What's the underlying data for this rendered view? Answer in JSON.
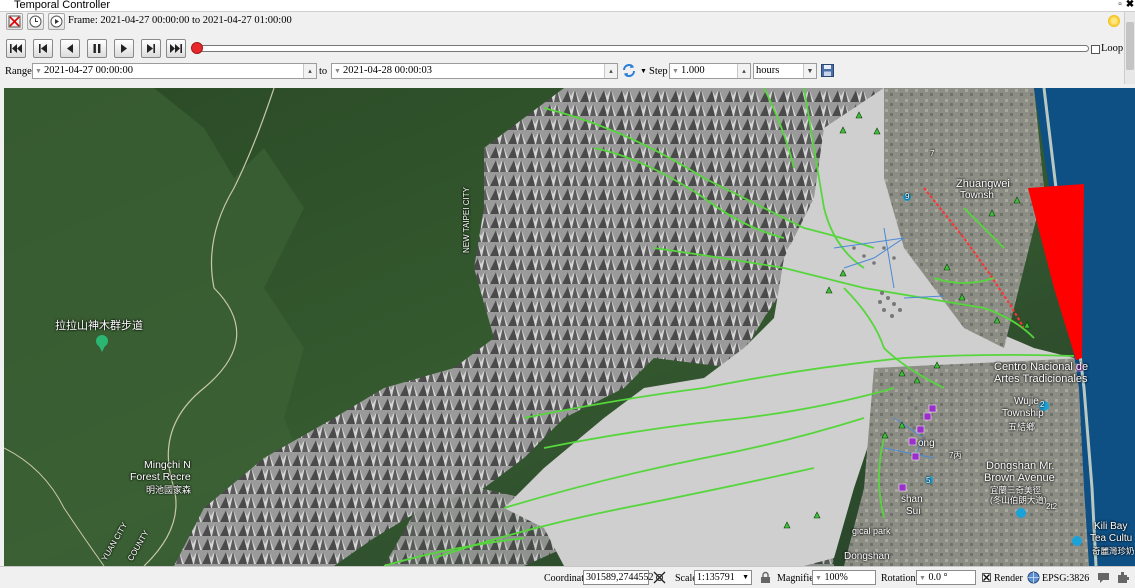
{
  "panel": {
    "title": "Temporal Controller"
  },
  "frame": {
    "text": "Frame: 2021-04-27 00:00:00 to 2021-04-27 01:00:00"
  },
  "playback": {
    "loop_label": "Loop",
    "loop_checked": false,
    "progress": 0.0
  },
  "range": {
    "label": "Range",
    "start": "2021-04-27 00:00:00",
    "to_label": "to",
    "end": "2021-04-28 00:00:03",
    "step_label": "Step",
    "step_value": "1.000",
    "unit": "hours"
  },
  "map_labels": {
    "new_taipei": "NEW TAIPEI CITY",
    "trail_cn": "拉拉山神木群步道",
    "mingchi_1": "Mingchi N",
    "mingchi_2": "Forest Recre",
    "mingchi_cn": "明池國家森",
    "yuan_city": "YUAN CITY",
    "county": "COUNTY",
    "zhuangwei_1": "Zhuangwei",
    "zhuangwei_2": "Townsh",
    "centro_1": "Centro Nacional de",
    "centro_2": "Artes Tradicionales",
    "wujie_1": "Wujie",
    "wujie_2": "Township",
    "wujie_cn": "五結鄉",
    "dongshan_1": "Dongshan Mr.",
    "dongshan_2": "Brown Avenue",
    "dongshan_cn1": "宜蘭三奇美徑",
    "dongshan_cn2": "(冬山伯朗大道)",
    "kilibay_1": "Kili Bay",
    "kilibay_2": "Tea Cultu",
    "kilibay_cn": "奇麗灣珍奶",
    "dongshan_town": "Dongshan",
    "song": "ong",
    "shan": "shan",
    "sui": "Sui",
    "geo_park": "gical park",
    "road_7": "7",
    "road_9": "9",
    "road_5": "5",
    "road_2": "2",
    "road_7a": "7丙",
    "road_1": "2t2"
  },
  "status": {
    "coordinate_label": "Coordinate",
    "coordinate_value": "301589,2744552",
    "scale_label": "Scale",
    "scale_value": "1:135791",
    "magnifier_label": "Magnifier",
    "magnifier_value": "100%",
    "rotation_label": "Rotation",
    "rotation_value": "0.0 °",
    "render_label": "Render",
    "render_checked": true,
    "crs_label": "EPSG:3826"
  },
  "icons": [
    "remove-icon",
    "clock-icon",
    "animate-icon",
    "sun-icon",
    "first-icon",
    "prev-frame-icon",
    "rewind-icon",
    "pause-icon",
    "play-icon",
    "next-frame-icon",
    "last-icon",
    "refresh-icon",
    "save-icon",
    "lock-icon",
    "crs-globe-icon",
    "messages-icon",
    "plugins-icon"
  ],
  "colors": {
    "slider_thumb": "#e8272c",
    "flood_red": "#ff0000",
    "river_green": "#56d63c"
  }
}
